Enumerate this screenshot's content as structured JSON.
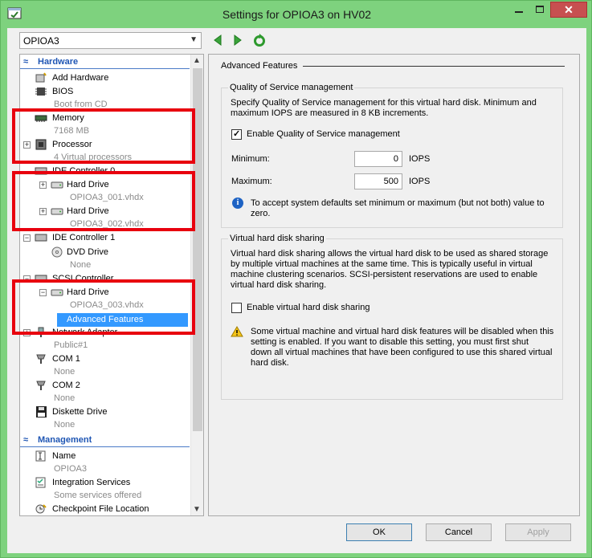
{
  "window": {
    "title": "Settings for OPIOA3 on HV02",
    "minimize_icon": "minimize-icon",
    "maximize_icon": "maximize-icon",
    "close_glyph": "✕"
  },
  "vm_selector": {
    "value": "OPIOA3"
  },
  "tree": {
    "hardware_header": "Hardware",
    "management_header": "Management",
    "items": {
      "add_hardware": "Add Hardware",
      "bios": "BIOS",
      "bios_sub": "Boot from CD",
      "memory": "Memory",
      "memory_sub": "7168 MB",
      "processor": "Processor",
      "processor_sub": "4 Virtual processors",
      "ide0": "IDE Controller 0",
      "hdd1": "Hard Drive",
      "hdd1_sub": "OPIOA3_001.vhdx",
      "hdd2": "Hard Drive",
      "hdd2_sub": "OPIOA3_002.vhdx",
      "ide1": "IDE Controller 1",
      "dvd": "DVD Drive",
      "dvd_sub": "None",
      "scsi": "SCSI Controller",
      "hdd3": "Hard Drive",
      "hdd3_sub": "OPIOA3_003.vhdx",
      "advanced": "Advanced Features",
      "network": "Network Adapter",
      "network_sub": "Public#1",
      "com1": "COM 1",
      "com1_sub": "None",
      "com2": "COM 2",
      "com2_sub": "None",
      "diskette": "Diskette Drive",
      "diskette_sub": "None",
      "name": "Name",
      "name_sub": "OPIOA3",
      "integration": "Integration Services",
      "integration_sub": "Some services offered",
      "checkpoint": "Checkpoint File Location"
    }
  },
  "detail": {
    "title": "Advanced Features",
    "qos": {
      "group_title": "Quality of Service management",
      "description_line1": "Specify Quality of Service management for this virtual hard disk. Minimum and",
      "description_line2": "maximum IOPS are measured in 8 KB increments.",
      "enable_label": "Enable Quality of Service management",
      "enable_checked": true,
      "minimum_label": "Minimum:",
      "minimum_value": "0",
      "maximum_label": "Maximum:",
      "maximum_value": "500",
      "unit": "IOPS",
      "info_line1": "To accept system defaults set minimum or maximum (but not both) value to",
      "info_line2": "zero."
    },
    "sharing": {
      "group_title": "Virtual hard disk sharing",
      "description_line1": "Virtual hard disk sharing allows the virtual hard disk to be used as shared storage",
      "description_line2": "by multiple virtual machines at the same time. This is typically useful in virtual",
      "description_line3": "machine clustering scenarios. SCSI-persistent reservations are used to enable",
      "description_line4": "virtual hard disk sharing.",
      "enable_label": "Enable virtual hard disk sharing",
      "enable_checked": false,
      "warning_line1": "Some virtual machine and virtual hard disk features will be disabled when this",
      "warning_line2": "setting is enabled. If you want to disable this setting, you must first shut",
      "warning_line3": "down all virtual machines that have been configured to use this shared virtual",
      "warning_line4": "hard disk."
    }
  },
  "buttons": {
    "ok": "OK",
    "cancel": "Cancel",
    "apply": "Apply"
  },
  "colors": {
    "accent": "#1f56b4",
    "selection": "#3399ff",
    "callout": "#e8000e",
    "window_frame": "#7ed27e"
  }
}
